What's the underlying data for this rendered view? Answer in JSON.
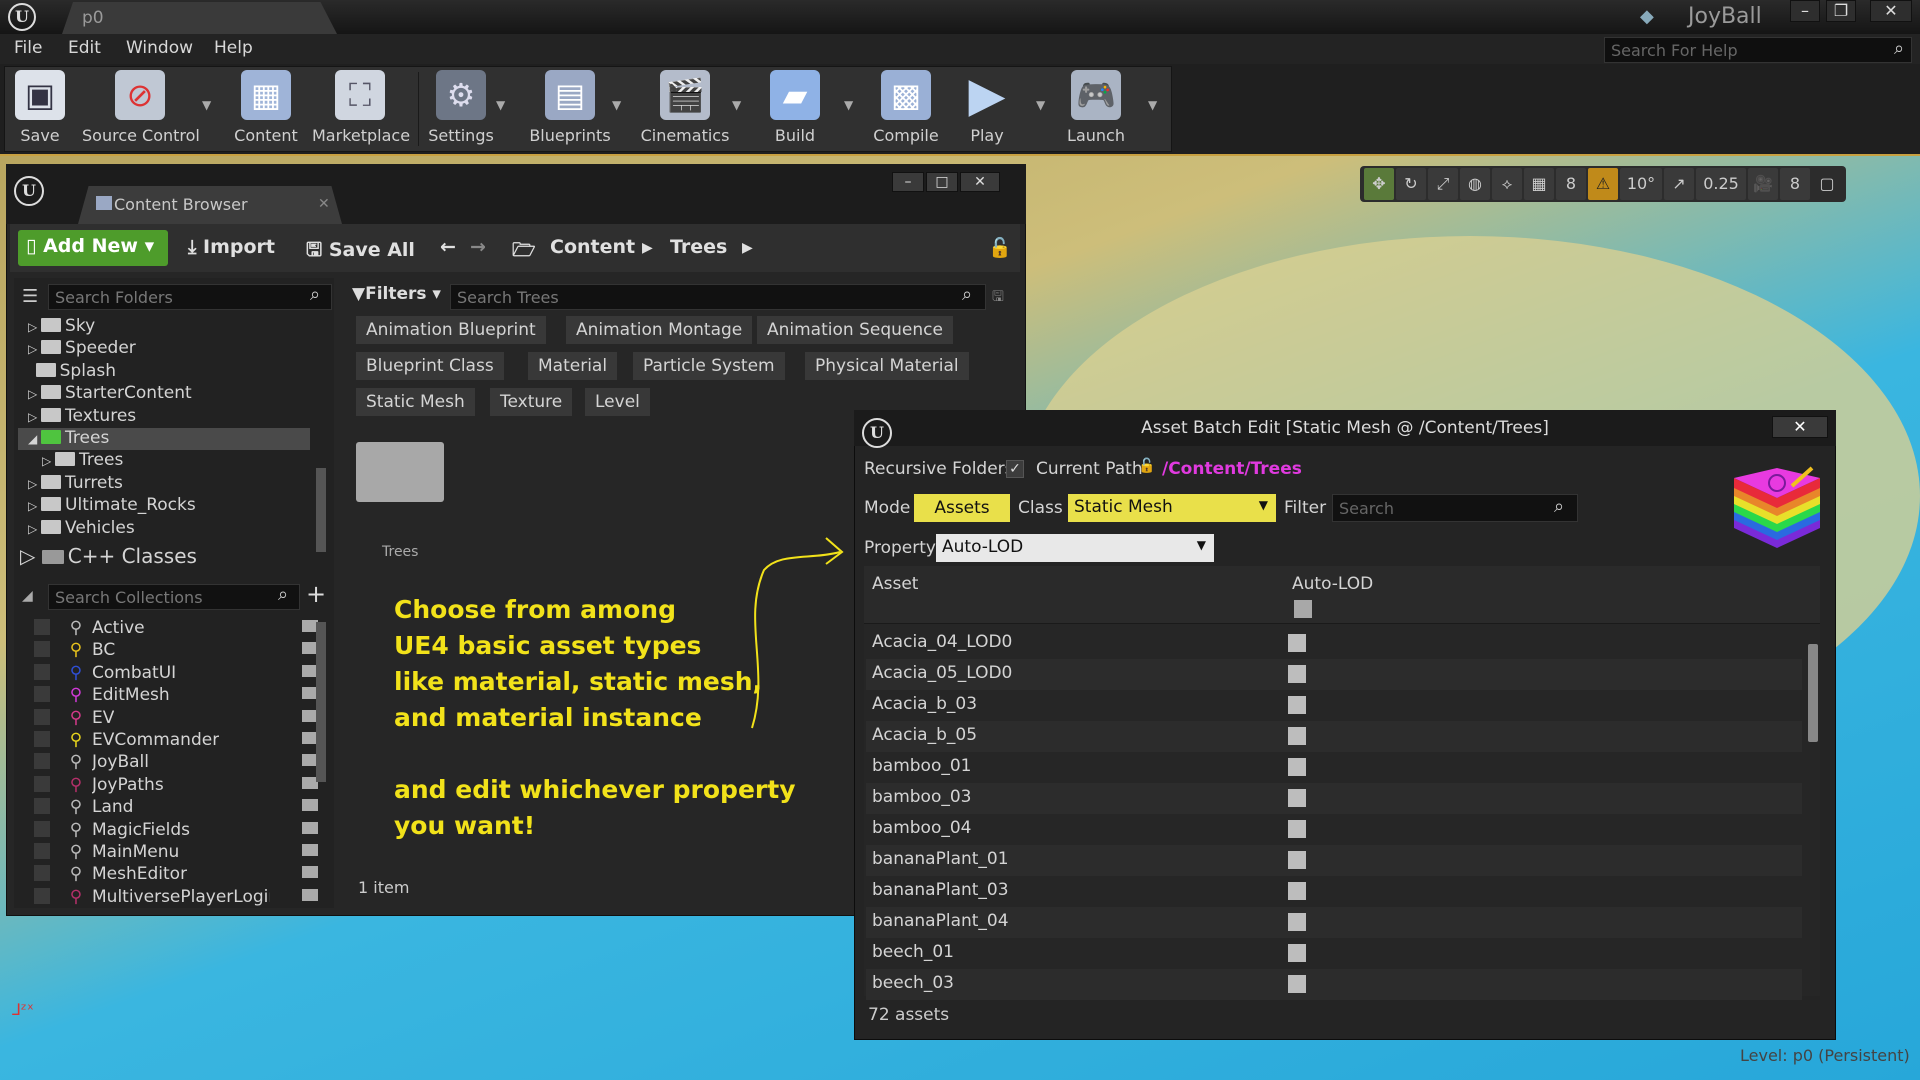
{
  "window": {
    "tab": "p0",
    "project": "JoyBall",
    "help_search_placeholder": "Search For Help"
  },
  "menu": [
    "File",
    "Edit",
    "Window",
    "Help"
  ],
  "toolbar": [
    {
      "label": "Save",
      "icon": "save-icon"
    },
    {
      "label": "Source Control",
      "icon": "source-control-icon"
    },
    {
      "label": "Content",
      "icon": "content-icon"
    },
    {
      "label": "Marketplace",
      "icon": "marketplace-icon"
    },
    {
      "label": "Settings",
      "icon": "settings-icon"
    },
    {
      "label": "Blueprints",
      "icon": "blueprints-icon"
    },
    {
      "label": "Cinematics",
      "icon": "cinematics-icon"
    },
    {
      "label": "Build",
      "icon": "build-icon"
    },
    {
      "label": "Compile",
      "icon": "compile-icon"
    },
    {
      "label": "Play",
      "icon": "play-icon"
    },
    {
      "label": "Launch",
      "icon": "launch-icon"
    }
  ],
  "viewport": {
    "grid": "8",
    "angle": "10°",
    "scale": "0.25",
    "camera_speed": "8",
    "level": "Level:  p0 (Persistent)"
  },
  "content_browser": {
    "tab": "Content Browser",
    "add_new": "Add New",
    "import": "Import",
    "save_all": "Save All",
    "path": [
      "Content",
      "Trees"
    ],
    "search_folders": "Search Folders",
    "folders": [
      {
        "label": "Sky",
        "indent": 0
      },
      {
        "label": "Speeder",
        "indent": 0
      },
      {
        "label": "Splash",
        "indent": 0
      },
      {
        "label": "StarterContent",
        "indent": 0
      },
      {
        "label": "Textures",
        "indent": 0
      },
      {
        "label": "Trees",
        "indent": 0
      },
      {
        "label": "Trees",
        "indent": 1
      },
      {
        "label": "Turrets",
        "indent": 0
      },
      {
        "label": "Ultimate_Rocks",
        "indent": 0
      },
      {
        "label": "Vehicles",
        "indent": 0
      }
    ],
    "cpp_classes": "C++ Classes",
    "search_collections": "Search Collections",
    "collections": [
      {
        "label": "Active",
        "color": "#bbbbbb"
      },
      {
        "label": "BC",
        "color": "#e8c21c"
      },
      {
        "label": "CombatUI",
        "color": "#2f4fd6"
      },
      {
        "label": "EditMesh",
        "color": "#d13ad8"
      },
      {
        "label": "EV",
        "color": "#d43a8a"
      },
      {
        "label": "EVCommander",
        "color": "#e8d41c"
      },
      {
        "label": "JoyBall",
        "color": "#bbbbbb"
      },
      {
        "label": "JoyPaths",
        "color": "#b5306a"
      },
      {
        "label": "Land",
        "color": "#bbbbbb"
      },
      {
        "label": "MagicFields",
        "color": "#bbbbbb"
      },
      {
        "label": "MainMenu",
        "color": "#bbbbbb"
      },
      {
        "label": "MeshEditor",
        "color": "#bbbbbb"
      },
      {
        "label": "MultiversePlayerLogin",
        "color": "#b5306a"
      }
    ],
    "filters": "Filters",
    "search_trees": "Search Trees",
    "filter_chips": [
      [
        "Animation Blueprint",
        "Animation Montage",
        "Animation Sequence"
      ],
      [
        "Blueprint Class",
        "Material",
        "Particle System",
        "Physical Material"
      ],
      [
        "Static Mesh",
        "Texture",
        "Level"
      ]
    ],
    "folder_item": "Trees",
    "item_count": "1 item"
  },
  "annotation": {
    "lines": [
      "Choose from among",
      "UE4 basic asset types",
      "like material, static mesh,",
      "and material instance",
      "",
      "and edit whichever property",
      "you want!"
    ]
  },
  "dialog": {
    "title": "Asset Batch Edit [Static Mesh @ /Content/Trees]",
    "recursive_label": "Recursive Folders",
    "current_path_label": "Current Path",
    "current_path": "/Content/Trees",
    "mode_label": "Mode",
    "mode_value": "Assets",
    "class_label": "Class",
    "class_value": "Static Mesh",
    "filter_label": "Filter",
    "filter_placeholder": "Search",
    "property_label": "Property",
    "property_value": "Auto-LOD",
    "col_asset": "Asset",
    "col_value": "Auto-LOD",
    "rows": [
      "Acacia_04_LOD0",
      "Acacia_05_LOD0",
      "Acacia_b_03",
      "Acacia_b_05",
      "bamboo_01",
      "bamboo_03",
      "bamboo_04",
      "bananaPlant_01",
      "bananaPlant_03",
      "bananaPlant_04",
      "beech_01",
      "beech_03"
    ],
    "footer": "72 assets"
  }
}
